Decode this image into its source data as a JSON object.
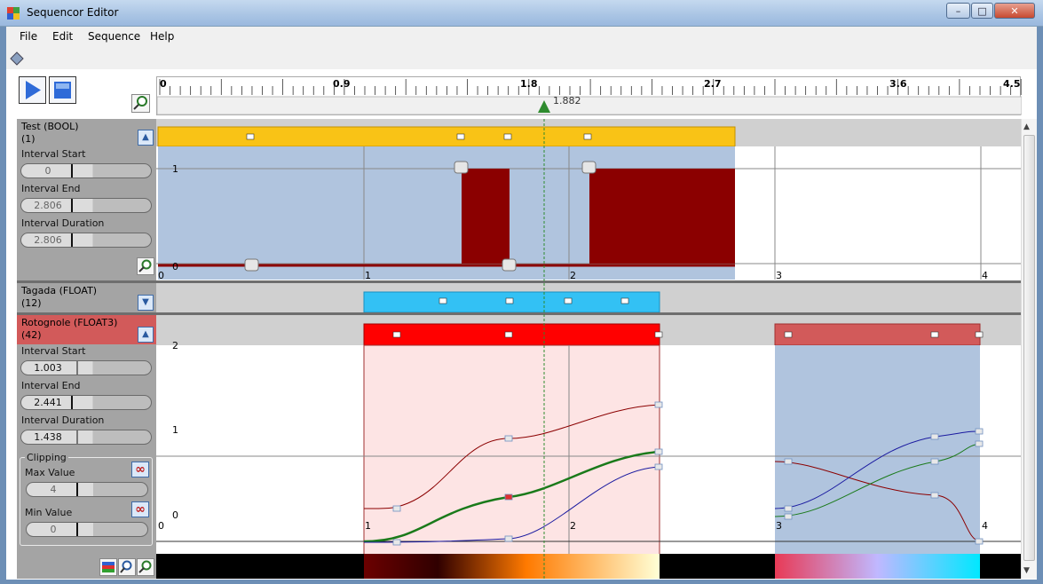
{
  "window": {
    "title": "Sequencor Editor",
    "min": "–",
    "max": "□",
    "close": "✕"
  },
  "menu": {
    "items": [
      "File",
      "Edit",
      "Sequence",
      "Help"
    ]
  },
  "toolbar": {
    "play_icon": "play-icon",
    "stop_icon": "stop-icon",
    "zoom_icon": "zoom-icon"
  },
  "ruler": {
    "labels": [
      "0",
      "0.9",
      "1.8",
      "2.7",
      "3.6",
      "4.5"
    ],
    "cursor_value": "1.882"
  },
  "tracks": {
    "test": {
      "name": "Test (BOOL)",
      "count": "(1)",
      "interval_start_label": "Interval Start",
      "interval_start": "0",
      "interval_end_label": "Interval End",
      "interval_end": "2.806",
      "interval_duration_label": "Interval Duration",
      "interval_duration": "2.806",
      "axis_y": [
        "1",
        "0"
      ],
      "axis_x": [
        "0",
        "1",
        "2",
        "3",
        "4"
      ]
    },
    "tagada": {
      "name": "Tagada (FLOAT)",
      "count": "(12)"
    },
    "rotognole": {
      "name": "Rotognole (FLOAT3)",
      "count": "(42)",
      "interval_start_label": "Interval Start",
      "interval_start": "1.003",
      "interval_end_label": "Interval End",
      "interval_end": "2.441",
      "interval_duration_label": "Interval Duration",
      "interval_duration": "1.438",
      "clipping_label": "Clipping",
      "max_label": "Max Value",
      "max_value": "4",
      "min_label": "Min Value",
      "min_value": "0",
      "axis_y": [
        "2",
        "1",
        "0"
      ],
      "axis_x": [
        "0",
        "1",
        "2",
        "3",
        "4"
      ]
    }
  },
  "colors": {
    "test_bar": "#f9c316",
    "tagada_bar": "#33c1f4",
    "rotognole_bar": "#ff0000",
    "rotognole_bar2": "#d25a5a",
    "interval_fill": "#b0c4de",
    "bool_fill": "#8b0000",
    "selection_fill": "#fde4e4"
  }
}
